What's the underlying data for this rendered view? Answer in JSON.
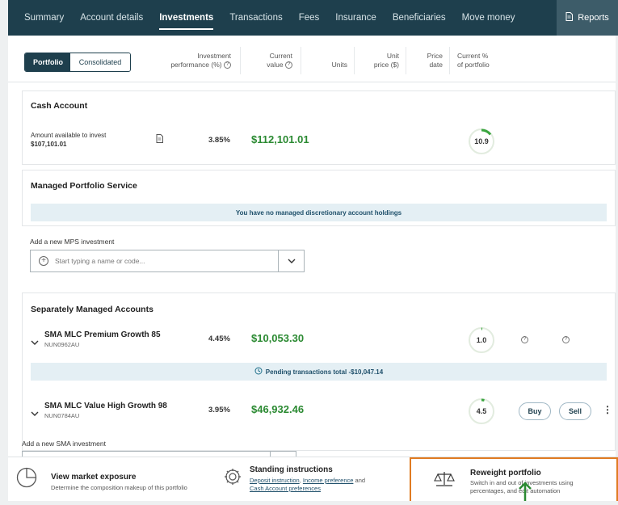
{
  "nav": {
    "tabs": [
      "Summary",
      "Account details",
      "Investments",
      "Transactions",
      "Fees",
      "Insurance",
      "Beneficiaries",
      "Move money"
    ],
    "active": "Investments",
    "reports_label": "Reports"
  },
  "columns": {
    "toggle_portfolio": "Portfolio",
    "toggle_consolidated": "Consolidated",
    "investment_performance": [
      "Investment",
      "performance (%)"
    ],
    "current_value": [
      "Current",
      "value"
    ],
    "units": "Units",
    "unit_price": [
      "Unit",
      "price ($)"
    ],
    "price_date": [
      "Price",
      "date"
    ],
    "current_pct": [
      "Current %",
      "of portfolio"
    ]
  },
  "cash": {
    "title": "Cash Account",
    "available_label": "Amount available to invest",
    "available_amount": "$107,101.01",
    "performance": "3.85%",
    "value": "$112,101.01",
    "portfolio_pct": "10.9"
  },
  "mps": {
    "title": "Managed Portfolio Service",
    "empty_message": "You have no managed discretionary account holdings",
    "add_label": "Add a new MPS investment",
    "search_placeholder": "Start typing a name or code..."
  },
  "sma": {
    "title": "Separately Managed Accounts",
    "holdings": [
      {
        "name": "SMA MLC Premium Growth 85",
        "code": "NUN0962AU",
        "performance": "4.45%",
        "value": "$10,053.30",
        "portfolio_pct": "1.0"
      },
      {
        "name": "SMA MLC Value High Growth 98",
        "code": "NUN0784AU",
        "performance": "3.95%",
        "value": "$46,932.46",
        "portfolio_pct": "4.5"
      }
    ],
    "pending_text": "Pending transactions total -$10,047.14",
    "buy_label": "Buy",
    "sell_label": "Sell",
    "add_label": "Add a new SMA investment"
  },
  "footer": {
    "market_title": "View market exposure",
    "market_desc": "Determine the composition makeup of this portfolio",
    "standing_title": "Standing instructions",
    "standing_link1": "Deposit instruction",
    "standing_sep1": ",",
    "standing_link2": "Income preference",
    "standing_and": "and",
    "standing_link3": "Cash Account preferences",
    "reweight_title": "Reweight portfolio",
    "reweight_desc1": "Switch in and out of investments using",
    "reweight_desc2": "percentages, and edit automation"
  },
  "colors": {
    "nav_bg": "#1e3f4d",
    "value_green": "#2b8a32",
    "highlight": "#e07b22",
    "banner_bg": "#e4eff4"
  }
}
